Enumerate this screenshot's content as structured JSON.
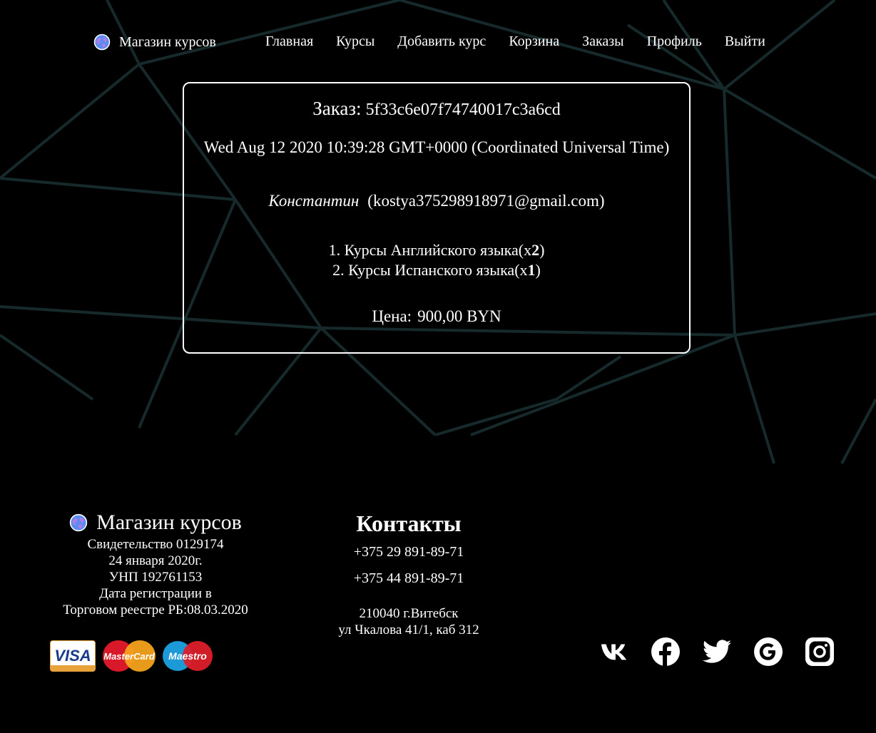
{
  "nav": {
    "brand": "Магазин курсов",
    "links": [
      "Главная",
      "Курсы",
      "Добавить курс",
      "Корзина",
      "Заказы",
      "Профиль",
      "Выйти"
    ]
  },
  "order": {
    "title_label": "Заказ:",
    "id": "5f33c6e07f74740017c3a6cd",
    "date": "Wed Aug 12 2020 10:39:28 GMT+0000 (Coordinated Universal Time)",
    "customer_name": "Константин",
    "customer_email": "(kostya375298918971@gmail.com)",
    "items": [
      {
        "prefix": "1. Курсы Английского языка(x",
        "qty": "2",
        "suffix": ")"
      },
      {
        "prefix": "2. Курсы Испанского языка(x",
        "qty": "1",
        "suffix": ")"
      }
    ],
    "price_label": "Цена:",
    "price_value": "900,00 BYN"
  },
  "footer": {
    "brand": "Магазин курсов",
    "info_lines": [
      "Свидетельство 0129174",
      "24 января 2020г.",
      "УНП 192761153",
      "Дата регистрации в",
      "Торговом реестре РБ:08.03.2020"
    ],
    "payments": [
      "VISA",
      "MasterCard",
      "Maestro"
    ],
    "contacts_title": "Контакты",
    "phones": [
      "+375 29 891-89-71",
      "+375 44 891-89-71"
    ],
    "address_lines": [
      "210040 г.Витебск",
      "ул Чкалова 41/1, каб 312"
    ],
    "socials": [
      "vk-icon",
      "facebook-icon",
      "twitter-icon",
      "google-icon",
      "instagram-icon"
    ]
  },
  "colors": {
    "background": "#000000",
    "text": "#ffffff",
    "bg_lines": "#16292b"
  }
}
